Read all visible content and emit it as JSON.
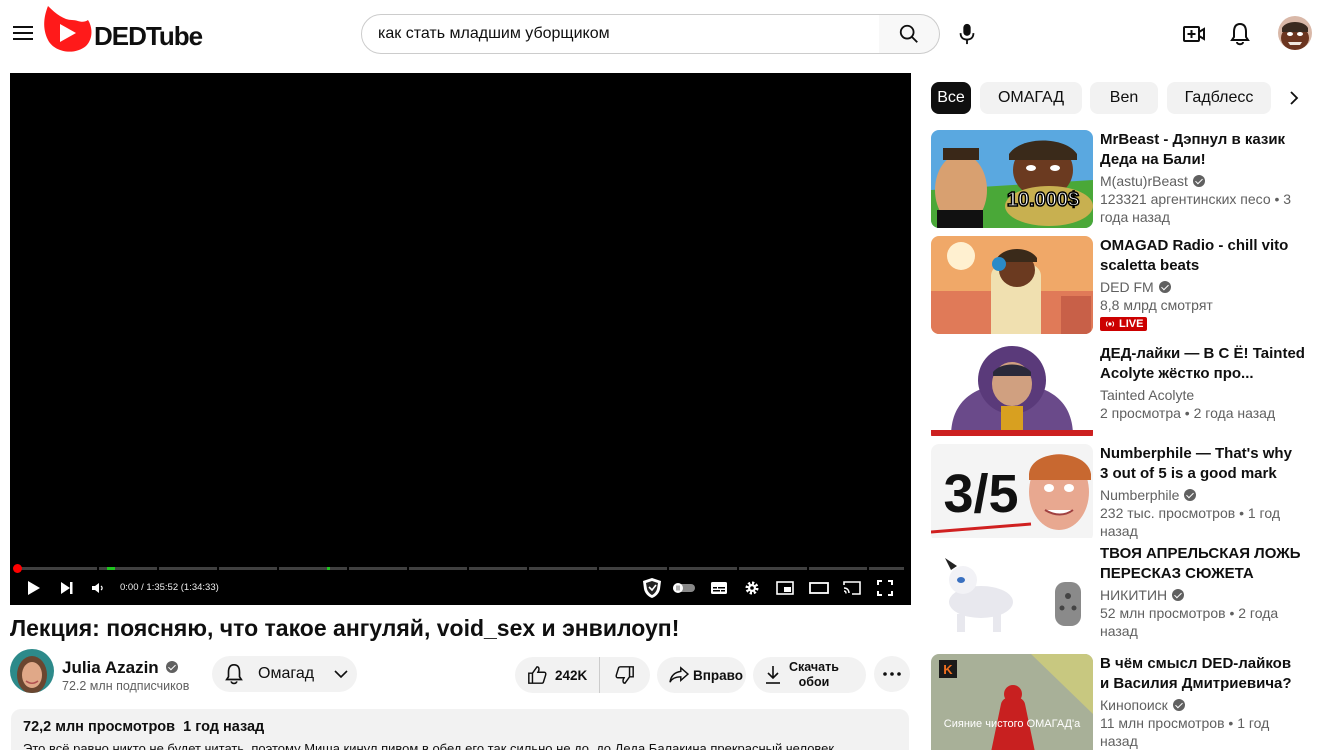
{
  "header": {
    "logo_text": "DEDTube",
    "search_value": "как стать младшим уборщиком"
  },
  "player": {
    "time": "0:00 / 1:35:52 (1:34:33)"
  },
  "video": {
    "title": "Лекция: поясняю, что такое ангуляй, void_sex и энвилоуп!",
    "channel_name": "Julia Azazin",
    "channel_subs": "72.2 млн подписчиков",
    "subscribe_label": "Омагад",
    "likes": "242K",
    "share_label": "Вправо",
    "download_label_1": "Скачать",
    "download_label_2": "обои",
    "desc_views": "72,2 млн просмотров",
    "desc_date": "1 год назад",
    "desc_text": "Это всё равно никто не будет читать, поэтому Миша кинул пивом в обед его так сильно не до, до Деда Балакина прекрасный человек"
  },
  "chips": [
    "Все",
    "ОМАГАД",
    "Ben",
    "Гадблесс"
  ],
  "recommendations": [
    {
      "title_1": "MrBeast - Дэпнул в казик",
      "title_2": "Деда на Бали!",
      "channel": "M(astu)rBeast",
      "meta_1": "123321 аргентинских песо • 3",
      "meta_2": "года назад",
      "thumb_text": "10.000$"
    },
    {
      "title_1": "OMAGAD Radio - chill vito",
      "title_2": "scaletta beats",
      "channel": "DED FM",
      "meta_1": "8,8 млрд смотрят",
      "live": "LIVE"
    },
    {
      "title_1": "ДЕД-лайки — В С Ё! Tainted",
      "title_2": "Acolyte жёстко про...",
      "channel": "Tainted Acolyte",
      "meta_1": "2 просмотра • 2 года назад"
    },
    {
      "title_1": "Numberphile — That's why",
      "title_2": "3 out of 5 is a good mark",
      "channel": "Numberphile",
      "meta_1": "232 тыс. просмотров • 1 год",
      "meta_2": "назад",
      "thumb_text": "3/5"
    },
    {
      "title_1": "ТВОЯ АПРЕЛЬСКАЯ ЛОЖЬ",
      "title_2": "ПЕРЕСКАЗ СЮЖЕТА",
      "channel": "НИКИТИН",
      "meta_1": "52 млн просмотров • 2 года",
      "meta_2": "назад"
    },
    {
      "title_1": "В чём смысл DED-лайков",
      "title_2": "и Василия Дмитриевича?",
      "channel": "Кинопоиск",
      "meta_1": "11 млн просмотров • 1 год",
      "meta_2": "назад",
      "thumb_text": "Сияние чистого ОМАГАД'а",
      "thumb_logo": "K"
    }
  ],
  "colors": {
    "brand_red": "#ff0000",
    "live_red": "#cc0000",
    "progress_marks": "#1ec41e"
  }
}
